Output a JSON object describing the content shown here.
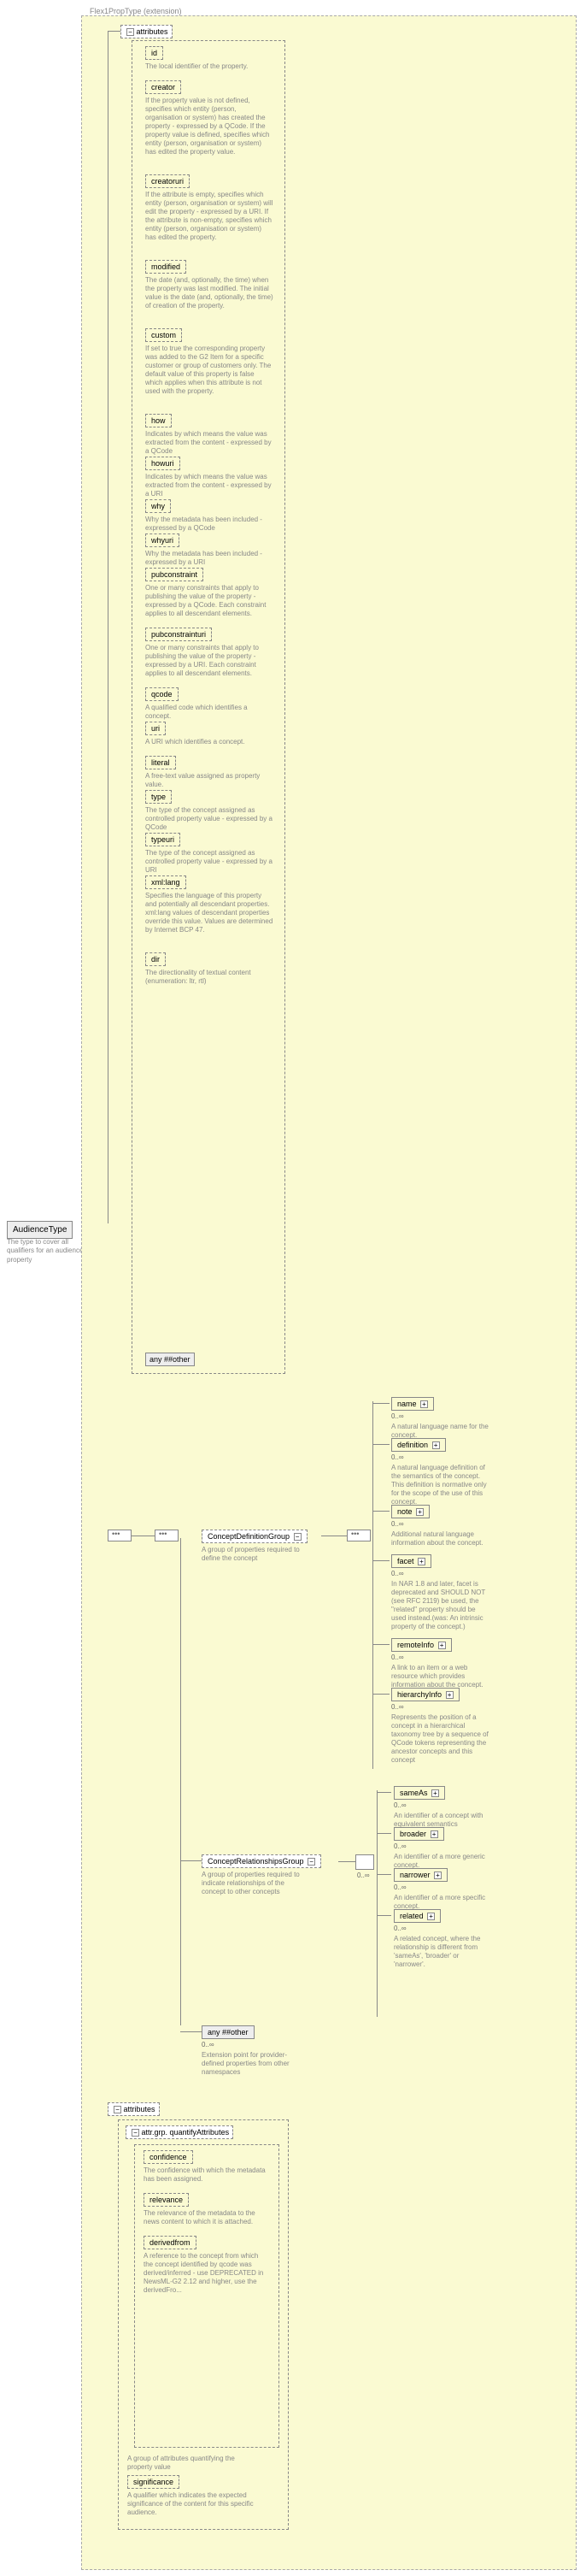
{
  "root": {
    "name": "AudienceType",
    "desc": "The type to cover all qualifiers for an audience property"
  },
  "ext": "Flex1PropType (extension)",
  "attrsLabel": "attributes",
  "anyOther": "any ##other",
  "attrs": [
    {
      "name": "id",
      "desc": "The local identifier of the property."
    },
    {
      "name": "creator",
      "desc": "If the property value is not defined, specifies which entity (person, organisation or system) has created the property - expressed by a QCode. If the property value is defined, specifies which entity (person, organisation or system) has edited the property value."
    },
    {
      "name": "creatoruri",
      "desc": "If the attribute is empty, specifies which entity (person, organisation or system) will edit the property - expressed by a URI. If the attribute is non-empty, specifies which entity (person, organisation or system) has edited the property."
    },
    {
      "name": "modified",
      "desc": "The date (and, optionally, the time) when the property was last modified. The initial value is the date (and, optionally, the time) of creation of the property."
    },
    {
      "name": "custom",
      "desc": "If set to true the corresponding property was added to the G2 Item for a specific customer or group of customers only. The default value of this property is false which applies when this attribute is not used with the property."
    },
    {
      "name": "how",
      "desc": "Indicates by which means the value was extracted from the content - expressed by a QCode"
    },
    {
      "name": "howuri",
      "desc": "Indicates by which means the value was extracted from the content - expressed by a URI"
    },
    {
      "name": "why",
      "desc": "Why the metadata has been included - expressed by a QCode"
    },
    {
      "name": "whyuri",
      "desc": "Why the metadata has been included - expressed by a URI"
    },
    {
      "name": "pubconstraint",
      "desc": "One or many constraints that apply to publishing the value of the property - expressed by a QCode. Each constraint applies to all descendant elements."
    },
    {
      "name": "pubconstrainturi",
      "desc": "One or many constraints that apply to publishing the value of the property - expressed by a URI. Each constraint applies to all descendant elements."
    },
    {
      "name": "qcode",
      "desc": "A qualified code which identifies a concept."
    },
    {
      "name": "uri",
      "desc": "A URI which identifies a concept."
    },
    {
      "name": "literal",
      "desc": "A free-text value assigned as property value."
    },
    {
      "name": "type",
      "desc": "The type of the concept assigned as controlled property value - expressed by a QCode"
    },
    {
      "name": "typeuri",
      "desc": "The type of the concept assigned as controlled property value - expressed by a URI"
    },
    {
      "name": "xml:lang",
      "desc": "Specifies the language of this property and potentially all descendant properties. xml:lang values of descendant properties override this value. Values are determined by Internet BCP 47."
    },
    {
      "name": "dir",
      "desc": "The directionality of textual content (enumeration: ltr, rtl)"
    }
  ],
  "cdg": {
    "title": "ConceptDefinitionGroup",
    "desc": "A group of properties required to define the concept",
    "items": [
      {
        "name": "name",
        "desc": "A natural language name for the concept."
      },
      {
        "name": "definition",
        "desc": "A natural language definition of the semantics of the concept. This definition is normative only for the scope of the use of this concept."
      },
      {
        "name": "note",
        "desc": "Additional natural language information about the concept."
      },
      {
        "name": "facet",
        "desc": "In NAR 1.8 and later, facet is deprecated and SHOULD NOT (see RFC 2119) be used, the \"related\" property should be used instead.(was: An intrinsic property of the concept.)"
      },
      {
        "name": "remoteInfo",
        "desc": "A link to an item or a web resource which provides information about the concept."
      },
      {
        "name": "hierarchyInfo",
        "desc": "Represents the position of a concept in a hierarchical taxonomy tree by a sequence of QCode tokens representing the ancestor concepts and this concept"
      }
    ]
  },
  "crg": {
    "title": "ConceptRelationshipsGroup",
    "desc": "A group of properties required to indicate relationships of the concept to other concepts",
    "items": [
      {
        "name": "sameAs",
        "desc": "An identifier of a concept with equivalent semantics"
      },
      {
        "name": "broader",
        "desc": "An identifier of a more generic concept."
      },
      {
        "name": "narrower",
        "desc": "An identifier of a more specific concept."
      },
      {
        "name": "related",
        "desc": "A related concept, where the relationship is different from 'sameAs', 'broader' or 'narrower'."
      }
    ]
  },
  "anyExt": {
    "label": "any ##other",
    "desc": "Extension point for provider-defined properties from other namespaces"
  },
  "qa": {
    "groupLabel": "attr.grp. quantifyAttributes",
    "desc": "A group of attributes quantifying the property value",
    "items": [
      {
        "name": "confidence",
        "desc": "The confidence with which the metadata has been assigned."
      },
      {
        "name": "relevance",
        "desc": "The relevance of the metadata to the news content to which it is attached."
      },
      {
        "name": "derivedfrom",
        "desc": "A reference to the concept from which the concept identified by qcode was derived/inferred - use DEPRECATED in NewsML-G2 2.12 and higher, use the derivedFro..."
      }
    ]
  },
  "sig": {
    "name": "significance",
    "desc": "A qualifier which indicates the expected significance of the content for this specific audience."
  },
  "card": "0..∞"
}
